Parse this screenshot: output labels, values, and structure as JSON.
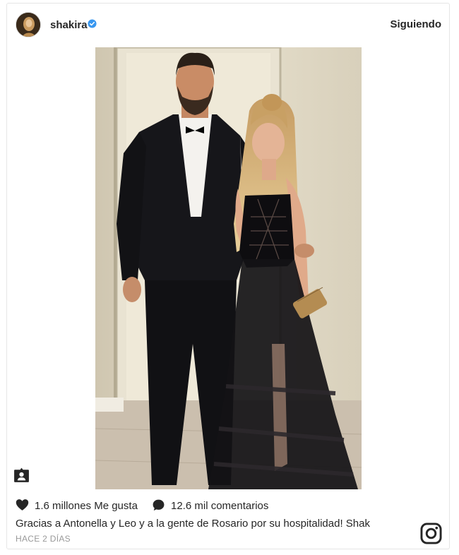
{
  "post": {
    "author": {
      "username": "shakira",
      "verified": true,
      "avatar_icon": "profile-avatar"
    },
    "follow_status": "Siguiendo",
    "photo": {
      "icon": "photo"
    },
    "stats": {
      "likes_text": "1.6 millones Me gusta",
      "comments_text": "12.6 mil comentarios"
    },
    "caption": "Gracias a Antonella y Leo y a la gente de Rosario por su hospitalidad! Shak",
    "time_ago": "HACE 2 DÍAS"
  },
  "icons": {
    "verified": "verified-badge-icon",
    "tag": "user-tag-icon",
    "like": "heart-icon",
    "comment": "comment-bubble-icon",
    "brand": "instagram-logo-icon"
  },
  "colors": {
    "verified_blue": "#3897f0",
    "text": "#262626",
    "muted": "#999999",
    "border": "#e6e6e6"
  }
}
